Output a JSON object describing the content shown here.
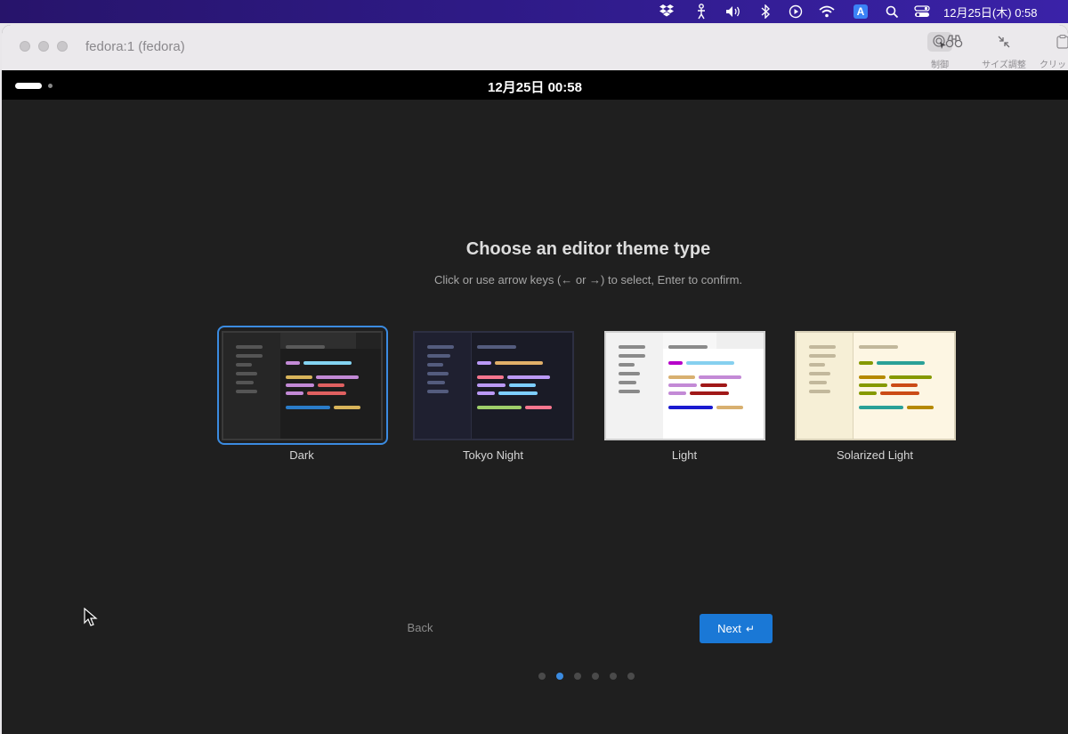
{
  "menubar": {
    "datetime": "12月25日(木) 0:58",
    "input_source": "A"
  },
  "window": {
    "title": "fedora:1 (fedora)",
    "toolbar": [
      {
        "label": "制御",
        "icon": "control-icon"
      },
      {
        "label": "",
        "icon": "binoculars-icon"
      },
      {
        "label": "サイズ調整",
        "icon": "resize-icon"
      },
      {
        "label": "クリッ",
        "icon": "clipboard-icon"
      }
    ]
  },
  "guest": {
    "clock": "12月25日  00:58"
  },
  "page": {
    "heading": "Choose an editor theme type",
    "subheading": "Click or use arrow keys (← or →) to select, Enter to confirm.",
    "themes": [
      {
        "label": "Dark",
        "selected": true
      },
      {
        "label": "Tokyo Night",
        "selected": false
      },
      {
        "label": "Light",
        "selected": false
      },
      {
        "label": "Solarized Light",
        "selected": false
      }
    ],
    "back_label": "Back",
    "next_label": "Next",
    "next_icon": "↵",
    "pager": {
      "total": 6,
      "current": 2
    }
  },
  "colors": {
    "accent": "#3b8be0",
    "next_button": "#1a78d6"
  }
}
